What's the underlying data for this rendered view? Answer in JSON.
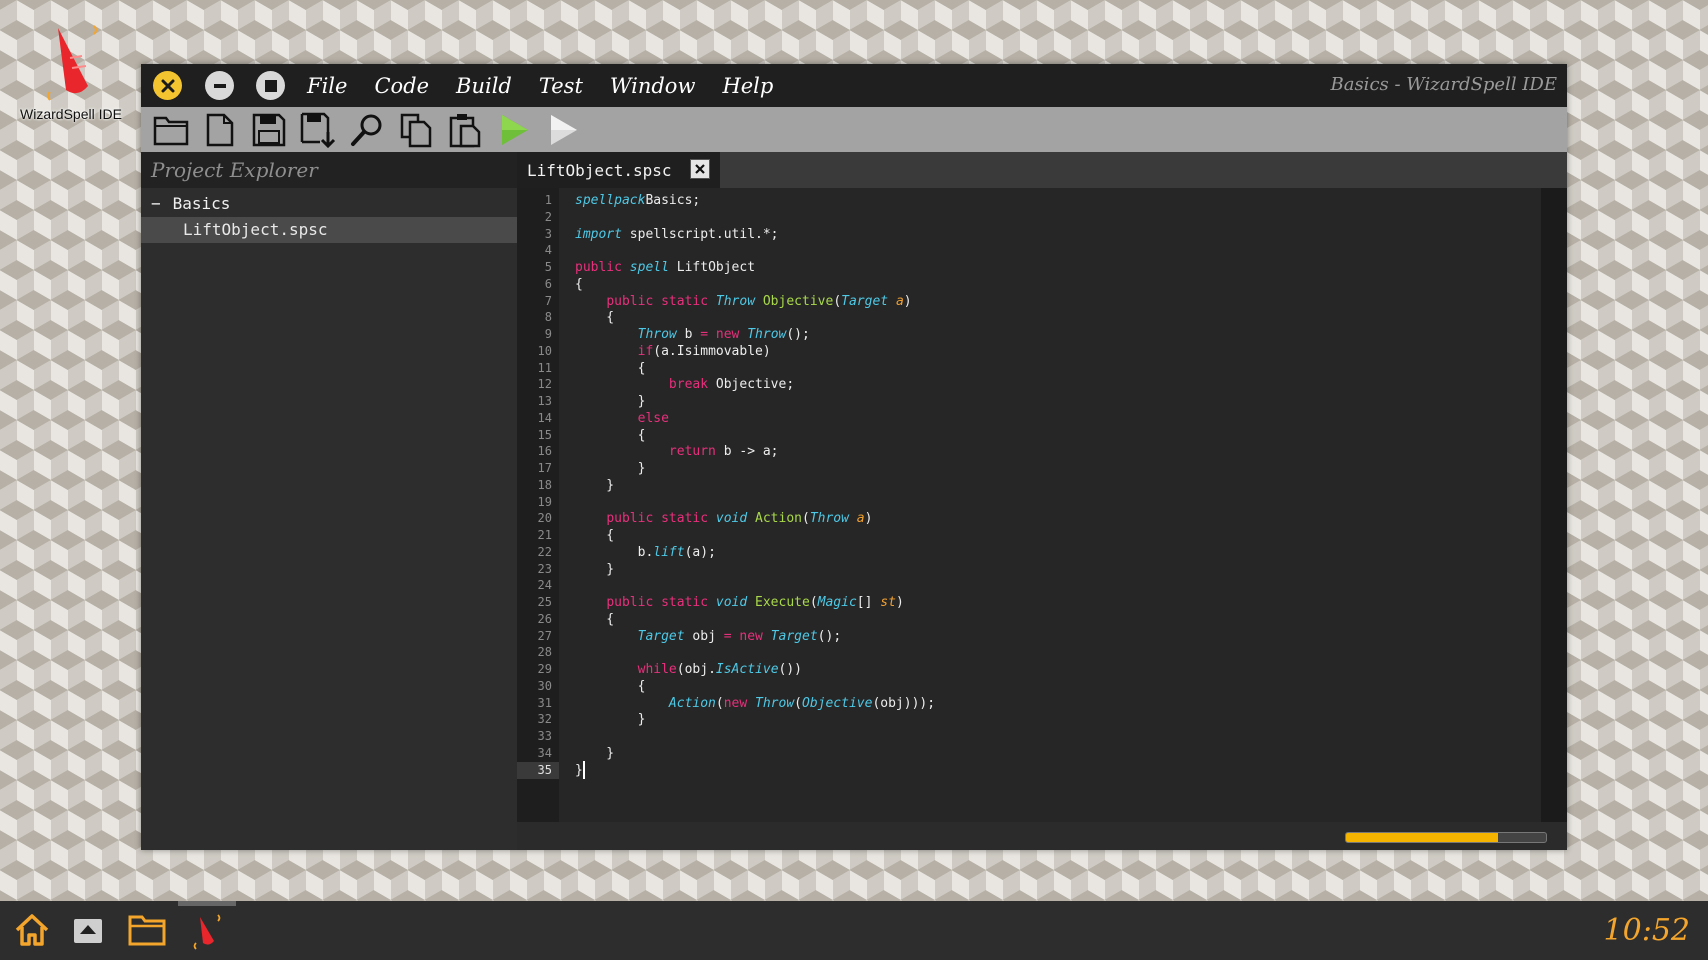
{
  "desktop": {
    "icon_label": "WizardSpell IDE"
  },
  "window": {
    "title": "Basics - WizardSpell IDE",
    "menu": [
      "File",
      "Code",
      "Build",
      "Test",
      "Window",
      "Help"
    ],
    "toolbar_icons": [
      "open-folder-icon",
      "new-file-icon",
      "save-icon",
      "save-as-icon",
      "search-icon",
      "copy-icon",
      "paste-icon",
      "run-icon",
      "run-alt-icon"
    ]
  },
  "project_explorer": {
    "title": "Project Explorer",
    "folder": "Basics",
    "folder_toggle": "−",
    "files": [
      "LiftObject.spsc"
    ]
  },
  "editor": {
    "tab_label": "LiftObject.spsc",
    "cursor_line": 35,
    "line_numbers": [
      "1",
      "2",
      "3",
      "4",
      "5",
      "6",
      "7",
      "8",
      "9",
      "10",
      "11",
      "12",
      "13",
      "14",
      "15",
      "16",
      "17",
      "18",
      "19",
      "20",
      "21",
      "22",
      "23",
      "24",
      "25",
      "26",
      "27",
      "28",
      "29",
      "30",
      "31",
      "32",
      "33",
      "34",
      "35"
    ],
    "progress": 0.76,
    "lines": [
      [
        [
          "ty",
          "spellpack"
        ],
        [
          "",
          "Basics;"
        ]
      ],
      [],
      [
        [
          "ty",
          "import"
        ],
        [
          "",
          " spellscript.util.*;"
        ]
      ],
      [],
      [
        [
          "kw",
          "public"
        ],
        [
          "",
          " "
        ],
        [
          "ty",
          "spell"
        ],
        [
          "",
          " LiftObject"
        ]
      ],
      [
        [
          "",
          "{"
        ]
      ],
      [
        [
          "",
          "    "
        ],
        [
          "kw",
          "public static"
        ],
        [
          "",
          " "
        ],
        [
          "ty",
          "Throw"
        ],
        [
          "",
          " "
        ],
        [
          "fn",
          "Objective"
        ],
        [
          "",
          "("
        ],
        [
          "ty",
          "Target"
        ],
        [
          "",
          " "
        ],
        [
          "pa",
          "a"
        ],
        [
          "",
          ")"
        ]
      ],
      [
        [
          "",
          "    {"
        ]
      ],
      [
        [
          "",
          "        "
        ],
        [
          "ty",
          "Throw"
        ],
        [
          "",
          " b "
        ],
        [
          "kw",
          "="
        ],
        [
          "",
          " "
        ],
        [
          "kw",
          "new"
        ],
        [
          "",
          " "
        ],
        [
          "ty",
          "Throw"
        ],
        [
          "",
          "();"
        ]
      ],
      [
        [
          "",
          "        "
        ],
        [
          "kw",
          "if"
        ],
        [
          "",
          "(a.Isimmovable)"
        ]
      ],
      [
        [
          "",
          "        {"
        ]
      ],
      [
        [
          "",
          "            "
        ],
        [
          "kw",
          "break"
        ],
        [
          "",
          " Objective;"
        ]
      ],
      [
        [
          "",
          "        }"
        ]
      ],
      [
        [
          "",
          "        "
        ],
        [
          "kw",
          "else"
        ]
      ],
      [
        [
          "",
          "        {"
        ]
      ],
      [
        [
          "",
          "            "
        ],
        [
          "kw",
          "return"
        ],
        [
          "",
          " b -> a;"
        ]
      ],
      [
        [
          "",
          "        }"
        ]
      ],
      [
        [
          "",
          "    }"
        ]
      ],
      [],
      [
        [
          "",
          "    "
        ],
        [
          "kw",
          "public static"
        ],
        [
          "",
          " "
        ],
        [
          "ty",
          "void"
        ],
        [
          "",
          " "
        ],
        [
          "fn",
          "Action"
        ],
        [
          "",
          "("
        ],
        [
          "ty",
          "Throw"
        ],
        [
          "",
          " "
        ],
        [
          "pa",
          "a"
        ],
        [
          "",
          ")"
        ]
      ],
      [
        [
          "",
          "    {"
        ]
      ],
      [
        [
          "",
          "        b."
        ],
        [
          "ty",
          "lift"
        ],
        [
          "",
          "(a);"
        ]
      ],
      [
        [
          "",
          "    }"
        ]
      ],
      [],
      [
        [
          "",
          "    "
        ],
        [
          "kw",
          "public static"
        ],
        [
          "",
          " "
        ],
        [
          "ty",
          "void"
        ],
        [
          "",
          " "
        ],
        [
          "fn",
          "Execute"
        ],
        [
          "",
          "("
        ],
        [
          "ty",
          "Magic"
        ],
        [
          "",
          "[] "
        ],
        [
          "pa",
          "st"
        ],
        [
          "",
          ")"
        ]
      ],
      [
        [
          "",
          "    {"
        ]
      ],
      [
        [
          "",
          "        "
        ],
        [
          "ty",
          "Target"
        ],
        [
          "",
          " obj "
        ],
        [
          "kw",
          "="
        ],
        [
          "",
          " "
        ],
        [
          "kw",
          "new"
        ],
        [
          "",
          " "
        ],
        [
          "ty",
          "Target"
        ],
        [
          "",
          "();"
        ]
      ],
      [],
      [
        [
          "",
          "        "
        ],
        [
          "kw",
          "while"
        ],
        [
          "",
          "(obj."
        ],
        [
          "ty",
          "IsActive"
        ],
        [
          "",
          "())"
        ]
      ],
      [
        [
          "",
          "        {"
        ]
      ],
      [
        [
          "",
          "            "
        ],
        [
          "ty",
          "Action"
        ],
        [
          "",
          "("
        ],
        [
          "kw",
          "new"
        ],
        [
          "",
          " "
        ],
        [
          "ty",
          "Throw"
        ],
        [
          "",
          "("
        ],
        [
          "ty",
          "Objective"
        ],
        [
          "",
          "(obj)));"
        ]
      ],
      [
        [
          "",
          "        }"
        ]
      ],
      [],
      [
        [
          "",
          "    }"
        ]
      ],
      [
        [
          "",
          "}"
        ]
      ]
    ]
  },
  "taskbar": {
    "clock": "10:52",
    "icons": [
      "home-icon",
      "eject-icon",
      "folder-icon",
      "wizard-hat-icon"
    ]
  },
  "colors": {
    "accent": "#f4a52c",
    "keyword": "#e6307b",
    "type": "#4ec9e6",
    "function": "#a9d94a",
    "param": "#f0a030"
  }
}
